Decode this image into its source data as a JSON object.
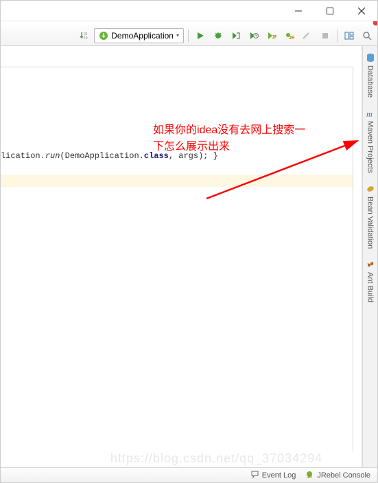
{
  "titlebar": {
    "minimize": "—",
    "maximize": "□",
    "close": "✕"
  },
  "toolbar": {
    "sort_update": "⇵",
    "run_config_name": "DemoApplication",
    "run_tooltip": "Run",
    "debug_tooltip": "Debug",
    "coverage_tooltip": "Run with Coverage",
    "profile_tooltip": "Profile",
    "jrebel_run_tooltip": "Run with JRebel",
    "jrebel_debug_tooltip": "Debug with JRebel",
    "stop_tooltip": "Stop",
    "structure_tooltip": "Project Structure",
    "search_tooltip": "Search Everywhere"
  },
  "editor": {
    "code_line": "lication.run(DemoApplication.class, args); }"
  },
  "annotation": {
    "line1": "如果你的idea没有去网上搜索一",
    "line2": "下怎么展示出来"
  },
  "right_rail": {
    "items": [
      {
        "label": "Database"
      },
      {
        "label": "Maven Projects"
      },
      {
        "label": "Bean Validation"
      },
      {
        "label": "Ant Build"
      }
    ]
  },
  "statusbar": {
    "event_log": "Event Log",
    "jrebel_console": "JRebel Console"
  },
  "watermark": "https://blog.csdn.net/qq_37034294"
}
